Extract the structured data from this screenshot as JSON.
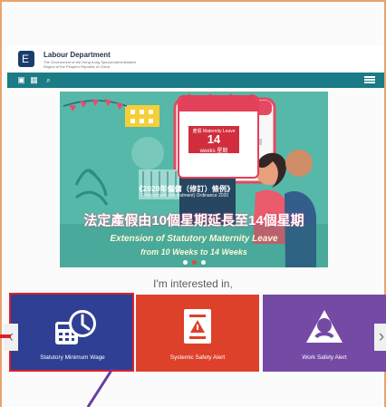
{
  "header": {
    "logo_char": "E",
    "title": "Labour Department",
    "subtitle": "The Government of the Hong Kong Special Administrative Region of the People's Republic of China"
  },
  "nav": {
    "items": [
      {
        "name": "home-icon",
        "glyph": "▣"
      },
      {
        "name": "grid-icon",
        "glyph": "▦"
      },
      {
        "name": "search-icon",
        "glyph": "⌕"
      }
    ],
    "menu_icon": "menu-icon"
  },
  "banner": {
    "title_cn": "《2020年僱傭（修訂）條例》",
    "title_en": "Employment (Amendment) Ordinance 2020",
    "box_small": "產假 Maternity Leave",
    "box_number": "14",
    "box_weeks": "weeks 星期",
    "headline_cn": "法定產假由10個星期延長至14個星期",
    "headline_en_1": "Extension of Statutory Maternity Leave",
    "headline_en_2": "from 10 Weeks to 14 Weeks",
    "carousel_index": 2,
    "carousel_total": 3
  },
  "section": {
    "title": "I'm interested in",
    "accent": ","
  },
  "tiles": [
    {
      "label": "Statutory Minimum Wage",
      "icon": "calculator-clock-icon",
      "color": "#2f3f93"
    },
    {
      "label": "Systemic Safety Alert",
      "icon": "document-alert-icon",
      "color": "#dd412a"
    },
    {
      "label": "Work Safety Alert",
      "icon": "warning-person-icon",
      "color": "#754aa5"
    }
  ],
  "arrows": {
    "left": "‹",
    "right": "›"
  }
}
